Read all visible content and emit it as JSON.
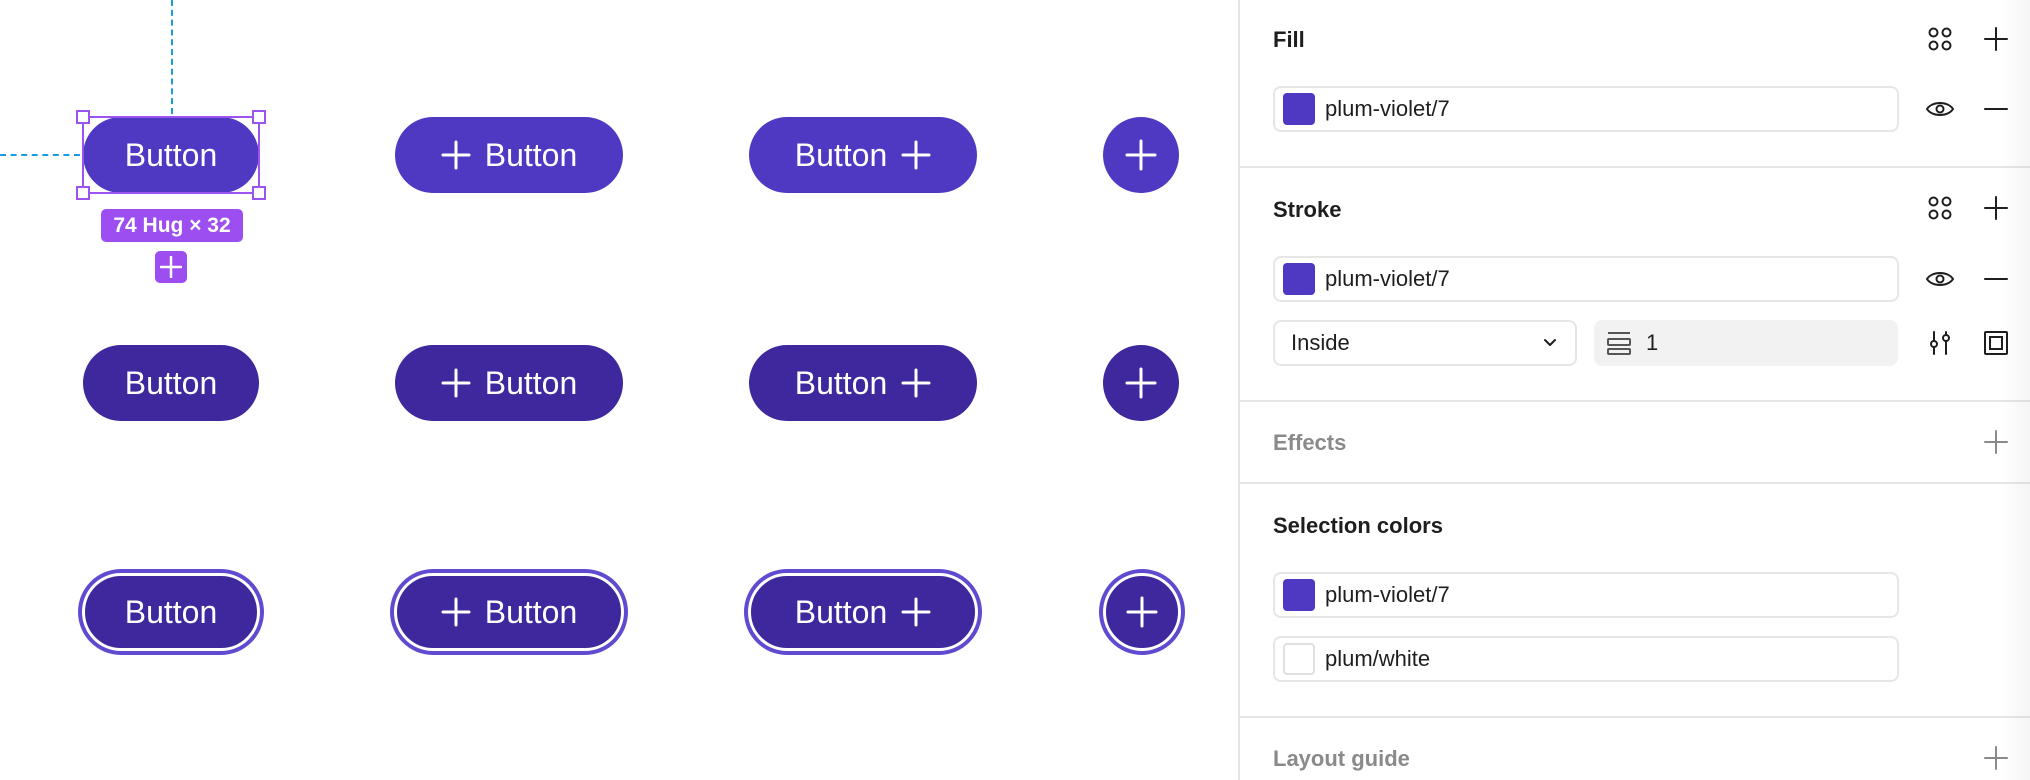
{
  "canvas": {
    "buttons": {
      "label": "Button",
      "fill_color": "#5039c2",
      "dark_color": "#3f289d",
      "stroke_color": "#5f4ad0"
    },
    "selection": {
      "size_label": "74 Hug × 32",
      "color": "#9d4ef1"
    },
    "guide_color": "#1b9be0"
  },
  "panel": {
    "fill": {
      "title": "Fill",
      "value": "plum-violet/7",
      "swatch": "#5039c2"
    },
    "stroke": {
      "title": "Stroke",
      "value": "plum-violet/7",
      "swatch": "#5039c2",
      "position": "Inside",
      "weight": "1"
    },
    "effects": {
      "title": "Effects"
    },
    "selection_colors": {
      "title": "Selection colors",
      "items": [
        {
          "value": "plum-violet/7",
          "swatch": "#5039c2"
        },
        {
          "value": "plum/white",
          "swatch": "#ffffff"
        }
      ]
    },
    "layout_guide": {
      "title": "Layout guide"
    }
  }
}
